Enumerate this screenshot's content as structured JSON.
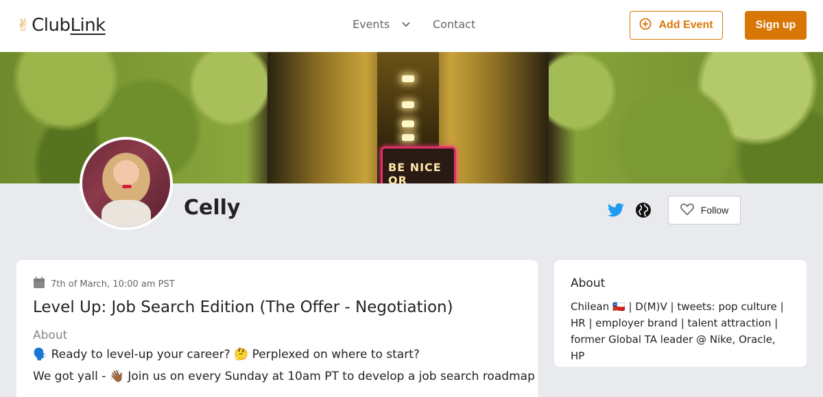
{
  "header": {
    "logo_prefix": "Club",
    "logo_suffix": "Link",
    "logo_hand": "✌",
    "nav_events": "Events",
    "nav_contact": "Contact",
    "add_event_label": "Add Event",
    "signup_label": "Sign up"
  },
  "banner": {
    "neon_text": "BE NICE OR"
  },
  "profile": {
    "name": "Celly",
    "follow_label": "Follow"
  },
  "event": {
    "date": "7th of March, 10:00 am PST",
    "title": "Level Up: Job Search Edition (The Offer - Negotiation)",
    "about_label": "About",
    "line1": "🗣️ Ready to level-up your career? 🤔 Perplexed on where to start?",
    "line2": "We got yall - 👋🏾 Join us on every Sunday at 10am PT to develop a job search roadmap"
  },
  "about": {
    "title": "About",
    "text": "Chilean 🇨🇱 | D(M)V | tweets: pop culture | HR | employer brand | talent attraction | former Global TA leader @ Nike, Oracle, HP"
  },
  "colors": {
    "accent": "#d97706",
    "twitter": "#1d9bf0"
  }
}
